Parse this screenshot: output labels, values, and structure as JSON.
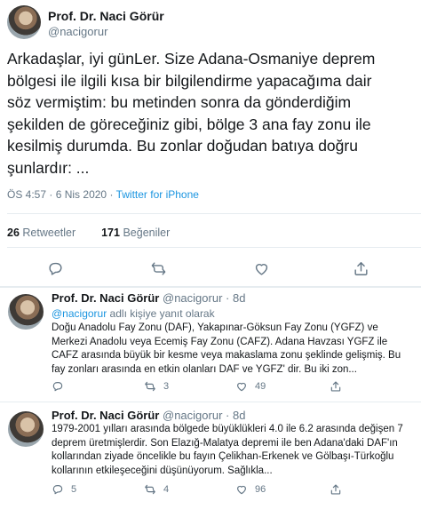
{
  "main_tweet": {
    "author_name": "Prof. Dr. Naci Görür",
    "author_handle": "@nacigorur",
    "text_lines": [
      "Arkadaşlar, iyi günLer. Size Adana-Osmaniye deprem",
      "bölgesi ile ilgili kısa bir bilgilendirme yapacağıma dair",
      "söz vermiştim: bu metinden sonra da gönderdiğim",
      "şekilden de göreceğiniz gibi, bölge 3 ana fay zonu ile",
      "kesilmiş durumda. Bu zonlar doğudan batıya doğru",
      "şunlardır: ..."
    ],
    "time": "ÖS 4:57",
    "date": "6 Nis 2020",
    "separator": "·",
    "source": "Twitter for iPhone",
    "retweets_count": "26",
    "retweets_label": "Retweetler",
    "likes_count": "171",
    "likes_label": "Beğeniler"
  },
  "icons": {
    "reply": "reply-icon",
    "retweet": "retweet-icon",
    "like": "heart-icon",
    "share": "share-icon"
  },
  "colors": {
    "link": "#1b95e0",
    "secondary": "#657786",
    "divider": "#e6ecf0"
  },
  "replies": [
    {
      "author_name": "Prof. Dr. Naci Görür",
      "author_handle": "@nacigorur",
      "age": "8d",
      "reply_to_handle": "@nacigorur",
      "reply_to_suffix": " adlı kişiye yanıt olarak",
      "text_lines": [
        "Doğu Anadolu Fay Zonu (DAF), Yakapınar-Göksun Fay Zonu (YGFZ) ve",
        "Merkezi Anadolu veya Ecemiş Fay Zonu (CAFZ).  Adana Havzası YGFZ ile",
        "CAFZ arasında büyük bir kesme veya makaslama zonu şeklinde gelişmiş. Bu",
        "fay zonları arasında en etkin olanları DAF ve YGFZ' dir. Bu iki zon..."
      ],
      "reply_count": "",
      "retweet_count": "3",
      "like_count": "49"
    },
    {
      "author_name": "Prof. Dr. Naci Görür",
      "author_handle": "@nacigorur",
      "age": "8d",
      "text_lines": [
        "1979-2001 yılları arasında bölgede büyüklükleri 4.0 ile 6.2 arasında değişen 7",
        "deprem üretmişlerdir. Son Elazığ-Malatya depremi ile ben Adana'daki DAF'ın",
        "kollarından ziyade öncelikle bu fayın Çelikhan-Erkenek ve Gölbaşı-Türkoğlu",
        "kollarının etkileşeceğini düşünüyorum. Sağlıkla..."
      ],
      "reply_count": "5",
      "retweet_count": "4",
      "like_count": "96"
    }
  ]
}
